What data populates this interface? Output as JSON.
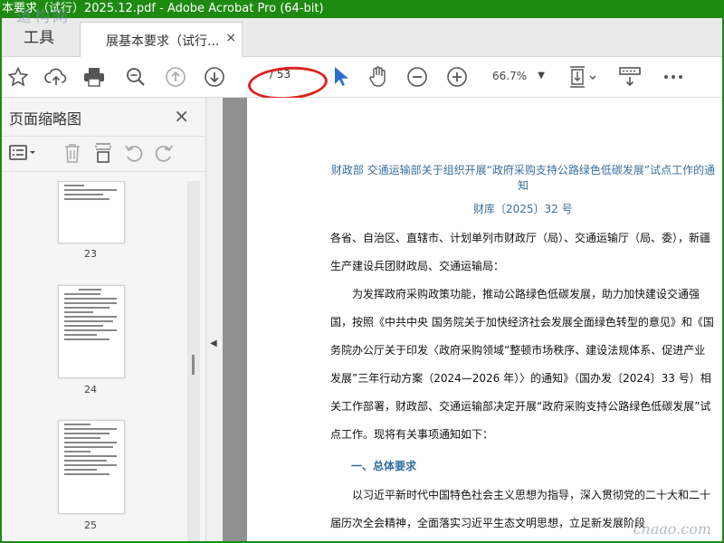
{
  "window": {
    "title": "本要求（试行）2025.12.pdf - Adobe Acrobat Pro (64-bit)"
  },
  "watermark_top": "道构网",
  "watermark_bottom": "cnaao.com",
  "tabs": {
    "tools": "工具",
    "document": "展基本要求（试行...",
    "close": "×"
  },
  "toolbar": {
    "page_current": "",
    "page_total": "/ 53",
    "zoom": "66.7%",
    "icons": [
      "star-icon",
      "cloud-upload-icon",
      "printer-icon",
      "zoom-out-search-icon",
      "page-up-icon",
      "page-down-icon",
      "cursor-icon",
      "hand-icon",
      "minus-circle-icon",
      "plus-circle-icon",
      "fit-page-icon",
      "scrolling-mode-icon",
      "more-icon"
    ]
  },
  "sidebar": {
    "title": "页面缩略图",
    "close": "×",
    "thumbnails": [
      {
        "label": "23"
      },
      {
        "label": "24"
      },
      {
        "label": "25"
      }
    ]
  },
  "document": {
    "title": "财政部  交通运输部关于组织开展“政府采购支持公路绿色低碳发展”试点工作的通知",
    "number": "财库〔2025〕32 号",
    "para1": "各省、自治区、直辖市、计划单列市财政厅（局）、交通运输厅（局、委），新疆生产建设兵团财政局、交通运输局：",
    "para2": "为发挥政府采购政策功能，推动公路绿色低碳发展，助力加快建设交通强国，按照《中共中央  国务院关于加快经济社会发展全面绿色转型的意见》和《国务院办公厅关于印发〈政府采购领域“整顿市场秩序、建设法规体系、促进产业发展”三年行动方案（2024—2026 年）〉的通知》（国办发〔2024〕33 号）相关工作部署，财政部、交通运输部决定开展“政府采购支持公路绿色低碳发展”试点工作。现将有关事项通知如下：",
    "section1": "一、总体要求",
    "para3": "以习近平新时代中国特色社会主义思想为指导，深入贯彻党的二十大和二十届历次全会精神，全面落实习近平生态文明思想，立足新发展阶段"
  }
}
